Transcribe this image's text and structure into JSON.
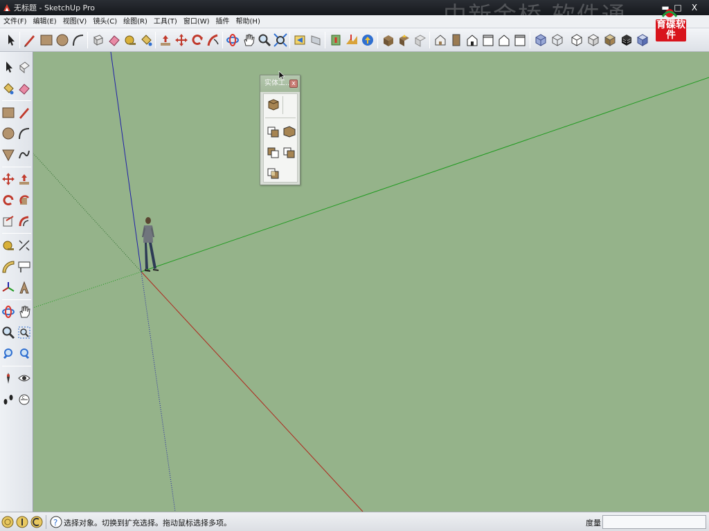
{
  "window": {
    "title": "无标题 - SketchUp Pro",
    "watermark": "中新金桥 软件通",
    "minimize_glyph": "▬",
    "maximize_glyph": "□",
    "close_glyph": "X"
  },
  "logo": {
    "text": "育碟软件"
  },
  "menu": [
    "文件(F)",
    "编辑(E)",
    "视图(V)",
    "镜头(C)",
    "绘图(R)",
    "工具(T)",
    "窗口(W)",
    "插件",
    "帮助(H)"
  ],
  "icons": {
    "top_toolbar": [
      "select-arrow-icon",
      "pencil-icon",
      "rectangle-icon",
      "circle-icon",
      "arc-icon",
      "make-component-icon",
      "eraser-icon",
      "tape-measure-icon",
      "paint-bucket-icon",
      "push-pull-icon",
      "move-icon",
      "rotate-icon",
      "follow-me-icon",
      "orbit-icon",
      "pan-icon",
      "zoom-icon",
      "zoom-extents-icon",
      "previous-view-icon",
      "next-view-icon",
      "add-location-icon",
      "toggle-terrain-icon",
      "get-models-icon",
      "share-model-icon",
      "share-component-icon",
      "get-photo-texture-icon",
      "iso-view-icon",
      "top-view-icon",
      "front-view-icon",
      "right-view-icon",
      "back-view-icon",
      "left-view-icon",
      "xray-icon",
      "wireframe-icon",
      "hidden-line-icon",
      "shaded-icon",
      "shaded-textures-icon",
      "monochrome-icon"
    ],
    "palette": [
      "outer-shell-icon",
      "intersect-icon",
      "union-icon",
      "subtract-icon",
      "trim-icon",
      "split-icon"
    ],
    "status": [
      "geo-location-icon",
      "credits-icon",
      "user-icon",
      "help-icon"
    ]
  },
  "palette": {
    "title": "实体工...",
    "close_glyph": "x"
  },
  "status": {
    "message": "选择对象。切换到扩充选择。拖动鼠标选择多项。",
    "measure_label": "度量",
    "measure_value": ""
  },
  "colors": {
    "viewport": "#95b38a",
    "axis_red": "#b0241b",
    "axis_green": "#1f9a1f",
    "axis_blue": "#1f1fa8",
    "logo_red": "#d8141c"
  }
}
